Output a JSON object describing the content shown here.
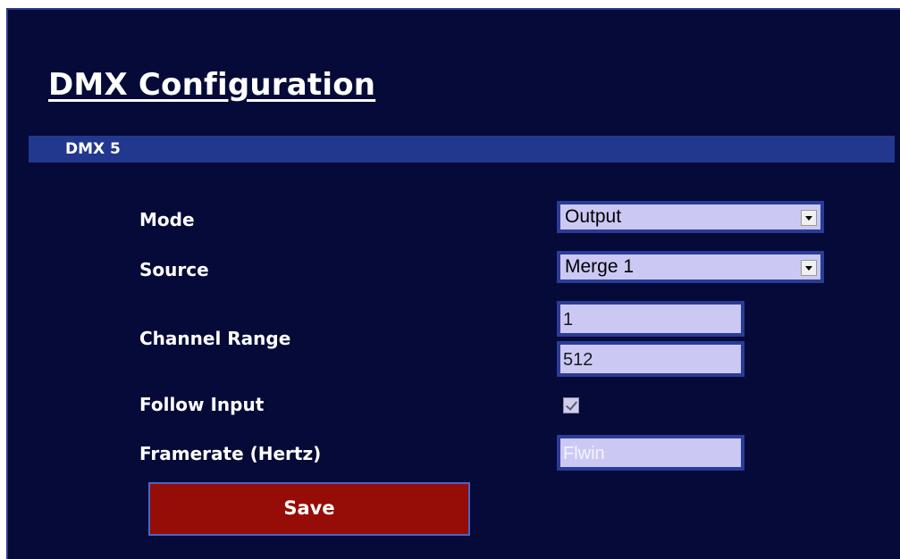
{
  "page": {
    "title": "DMX Configuration"
  },
  "section": {
    "label": "DMX 5"
  },
  "fields": {
    "mode": {
      "label": "Mode",
      "value": "Output"
    },
    "source": {
      "label": "Source",
      "value": "Merge 1"
    },
    "channel_range": {
      "label": "Channel Range",
      "start": "1",
      "end": "512"
    },
    "follow_input": {
      "label": "Follow Input",
      "checked": true
    },
    "framerate": {
      "label": "Framerate (Hertz)",
      "value": "Flwin"
    }
  },
  "actions": {
    "save_label": "Save"
  },
  "colors": {
    "background": "#050a38",
    "section_bar": "#22388e",
    "input_fill": "#cbc9f4",
    "input_border": "#2a3c95",
    "save_button": "#950d06"
  }
}
